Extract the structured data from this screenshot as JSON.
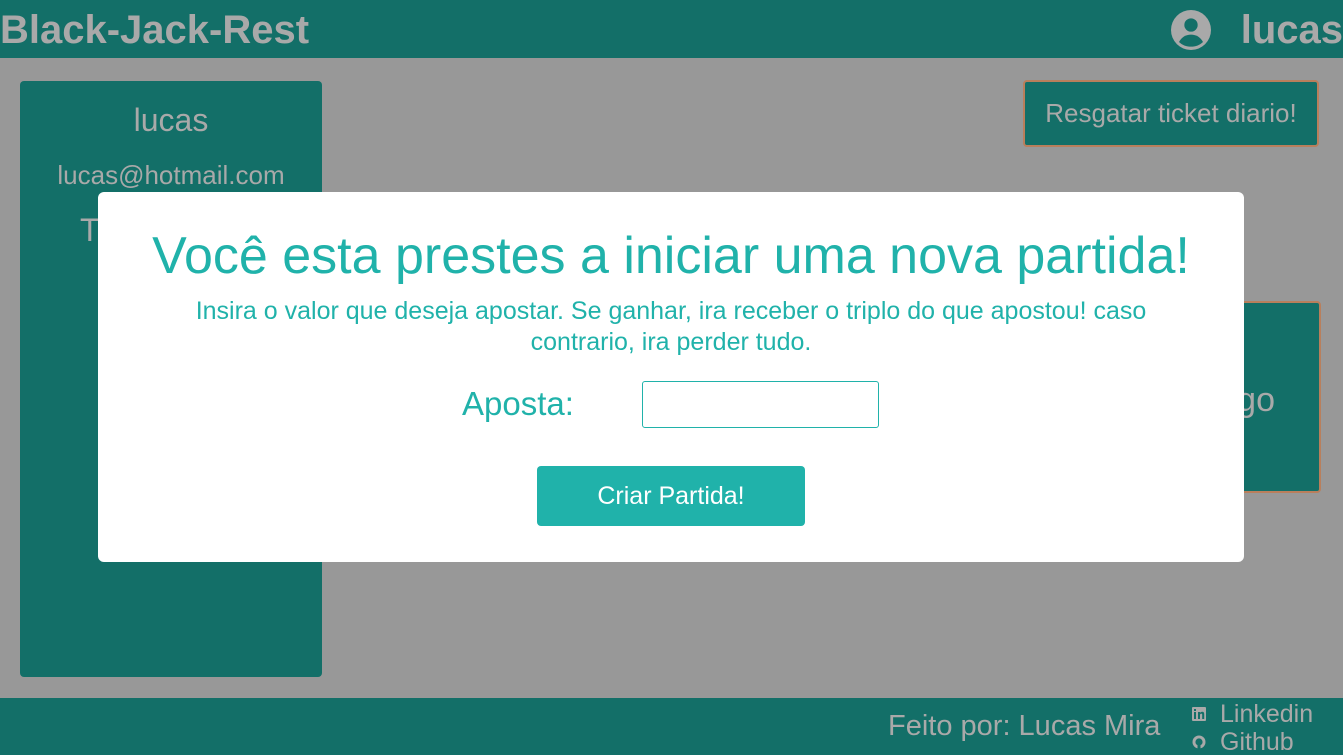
{
  "header": {
    "title": "Black-Jack-Rest",
    "username": "lucas",
    "user_icon": "account-circle-icon"
  },
  "profile": {
    "name": "lucas",
    "email": "lucas@hotmail.com",
    "tickets_partial": "T"
  },
  "actions": {
    "daily_ticket_label": "Resgatar ticket diario!",
    "new_game_partial_label": "go"
  },
  "modal": {
    "title": "Você esta prestes a iniciar uma nova partida!",
    "description": "Insira o valor que deseja apostar. Se ganhar, ira receber o triplo do que apostou! caso contrario, ira perder tudo.",
    "bet_label": "Aposta:",
    "bet_value": "",
    "submit_label": "Criar Partida!"
  },
  "footer": {
    "credit": "Feito por: Lucas Mira",
    "links": [
      {
        "label": "Linkedin",
        "icon": "linkedin-icon"
      },
      {
        "label": "Github",
        "icon": "github-icon"
      }
    ]
  },
  "colors": {
    "primary": "#136f68",
    "accent": "#20b2aa",
    "muted_text": "#a9a9a9",
    "overlay": "#989898",
    "button_border": "#b97f5c"
  }
}
